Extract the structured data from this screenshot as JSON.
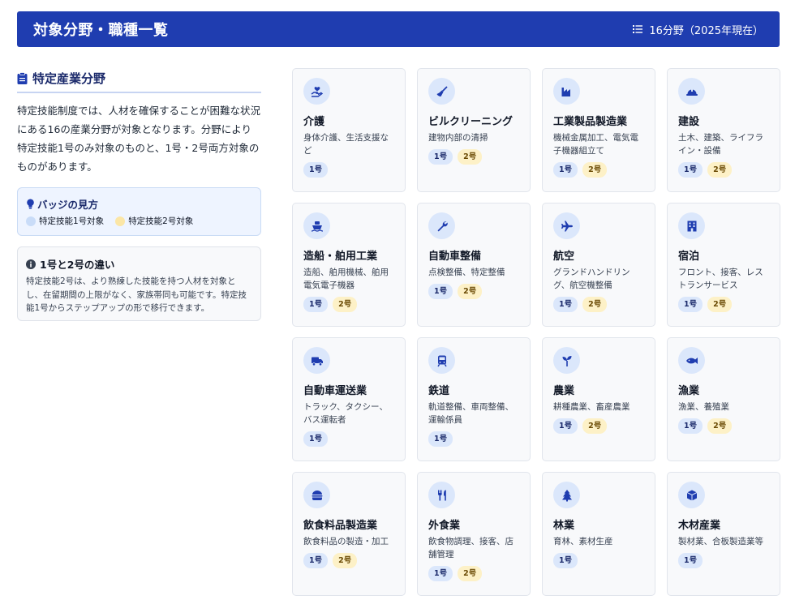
{
  "header": {
    "title": "対象分野・職種一覧",
    "count": "16分野（2025年現在）"
  },
  "section": {
    "title": "特定産業分野",
    "description": "特定技能制度では、人材を確保することが困難な状況にある16の産業分野が対象となります。分野により特定技能1号のみ対象のものと、1号・2号両方対象のものがあります。"
  },
  "legend": {
    "title": "バッジの見方",
    "item1": "特定技能1号対象",
    "item2": "特定技能2号対象"
  },
  "note": {
    "title": "1号と2号の違い",
    "text": "特定技能2号は、より熟練した技能を持つ人材を対象とし、在留期間の上限がなく、家族帯同も可能です。特定技能1号からステップアップの形で移行できます。"
  },
  "badge_labels": {
    "b1": "1号",
    "b2": "2号"
  },
  "fields": [
    {
      "title": "介護",
      "desc": "身体介護、生活支援など",
      "icon": "care-icon",
      "badges": [
        "1号"
      ]
    },
    {
      "title": "ビルクリーニング",
      "desc": "建物内部の清掃",
      "icon": "broom-icon",
      "badges": [
        "1号",
        "2号"
      ]
    },
    {
      "title": "工業製品製造業",
      "desc": "機械金属加工、電気電子機器組立て",
      "icon": "factory-icon",
      "badges": [
        "1号",
        "2号"
      ]
    },
    {
      "title": "建設",
      "desc": "土木、建築、ライフライン・設備",
      "icon": "hardhat-icon",
      "badges": [
        "1号",
        "2号"
      ]
    },
    {
      "title": "造船・舶用工業",
      "desc": "造船、舶用機械、舶用電気電子機器",
      "icon": "ship-icon",
      "badges": [
        "1号",
        "2号"
      ]
    },
    {
      "title": "自動車整備",
      "desc": "点検整備、特定整備",
      "icon": "wrench-icon",
      "badges": [
        "1号",
        "2号"
      ]
    },
    {
      "title": "航空",
      "desc": "グランドハンドリング、航空機整備",
      "icon": "plane-icon",
      "badges": [
        "1号",
        "2号"
      ]
    },
    {
      "title": "宿泊",
      "desc": "フロント、接客、レストランサービス",
      "icon": "hotel-icon",
      "badges": [
        "1号",
        "2号"
      ]
    },
    {
      "title": "自動車運送業",
      "desc": "トラック、タクシー、バス運転者",
      "icon": "truck-icon",
      "badges": [
        "1号"
      ]
    },
    {
      "title": "鉄道",
      "desc": "軌道整備、車両整備、運輸係員",
      "icon": "train-icon",
      "badges": [
        "1号"
      ]
    },
    {
      "title": "農業",
      "desc": "耕種農業、畜産農業",
      "icon": "seedling-icon",
      "badges": [
        "1号",
        "2号"
      ]
    },
    {
      "title": "漁業",
      "desc": "漁業、養殖業",
      "icon": "fish-icon",
      "badges": [
        "1号",
        "2号"
      ]
    },
    {
      "title": "飲食料品製造業",
      "desc": "飲食料品の製造・加工",
      "icon": "burger-icon",
      "badges": [
        "1号",
        "2号"
      ]
    },
    {
      "title": "外食業",
      "desc": "飲食物調理、接客、店舗管理",
      "icon": "utensils-icon",
      "badges": [
        "1号",
        "2号"
      ]
    },
    {
      "title": "林業",
      "desc": "育林、素材生産",
      "icon": "tree-icon",
      "badges": [
        "1号"
      ]
    },
    {
      "title": "木材産業",
      "desc": "製材業、合板製造業等",
      "icon": "cube-icon",
      "badges": [
        "1号"
      ]
    }
  ]
}
